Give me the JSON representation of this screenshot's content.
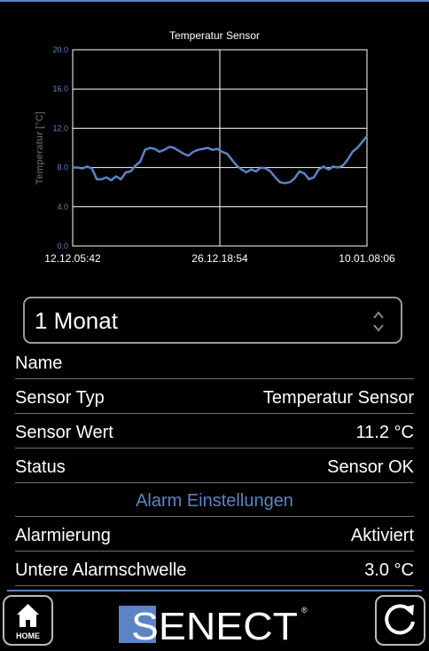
{
  "chart_data": {
    "type": "line",
    "title": "Temperatur Sensor",
    "ylabel": "Temperatur [°C]",
    "ylim": [
      0,
      20
    ],
    "yticks": [
      "0.0",
      "4.0",
      "8.0",
      "12.0",
      "16.0",
      "20.0"
    ],
    "xticks": [
      "12.12.05:42",
      "26.12.18:54",
      "10.01.08:06"
    ],
    "grid": true,
    "line_color": "#5b84c4",
    "series": [
      {
        "values": [
          8.0,
          8.0,
          7.9,
          8.1,
          7.9,
          6.8,
          6.8,
          7.0,
          6.7,
          7.1,
          6.8,
          7.5,
          7.6,
          8.2,
          8.6,
          9.8,
          10.0,
          9.9,
          9.6,
          9.8,
          10.1,
          10.0,
          9.7,
          9.4,
          9.2,
          9.6,
          9.8,
          9.9,
          10.0,
          9.8,
          9.9,
          9.6,
          9.4,
          8.8,
          8.2,
          7.8,
          7.5,
          7.8,
          7.6,
          8.0,
          7.9,
          7.6,
          7.0,
          6.5,
          6.4,
          6.5,
          6.9,
          7.6,
          7.4,
          6.8,
          7.0,
          7.8,
          8.1,
          7.8,
          8.1,
          8.0,
          8.2,
          8.8,
          9.6,
          10.0,
          10.6,
          11.2
        ]
      }
    ]
  },
  "select": {
    "value": "1 Monat"
  },
  "rows": [
    {
      "label": "Name",
      "value": ""
    },
    {
      "label": "Sensor Typ",
      "value": "Temperatur Sensor"
    },
    {
      "label": "Sensor Wert",
      "value": "11.2 °C"
    },
    {
      "label": "Status",
      "value": "Sensor OK"
    }
  ],
  "section_header": "Alarm Einstellungen",
  "alarm_rows": [
    {
      "label": "Alarmierung",
      "value": "Aktiviert"
    },
    {
      "label": "Untere Alarmschwelle",
      "value": "3.0 °C"
    }
  ],
  "footer": {
    "home_label": "HOME",
    "logo_text": "SENECT",
    "logo_mark": "®"
  },
  "colors": {
    "accent": "#5b84c4",
    "background": "#000000"
  }
}
